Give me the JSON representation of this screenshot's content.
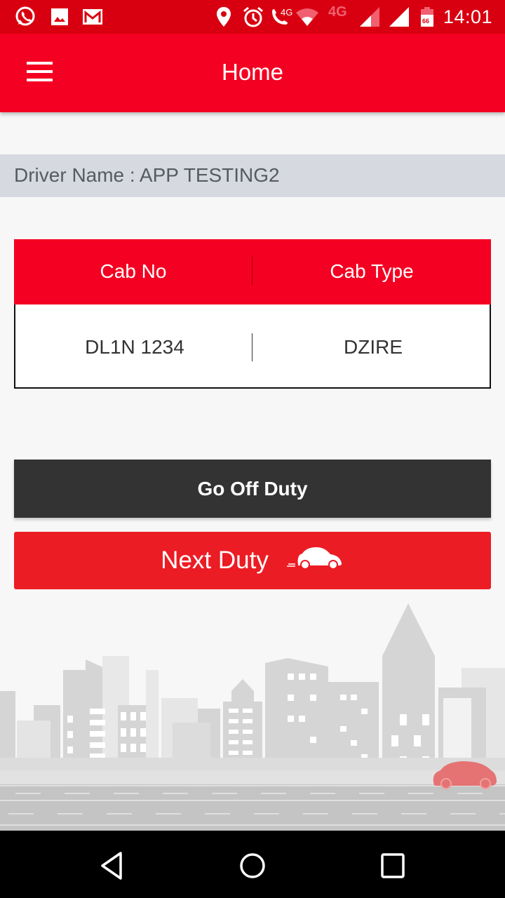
{
  "status_bar": {
    "left_icons": [
      "whatsapp-icon",
      "gallery-icon",
      "gmail-icon"
    ],
    "right_icons": [
      "location-icon",
      "alarm-icon",
      "volte-call-icon",
      "wifi-icon",
      "4g-icon",
      "signal-icon",
      "signal-icon",
      "battery-icon"
    ],
    "call_label": "4G",
    "network_label": "4G",
    "battery_level": "66",
    "time": "14:01"
  },
  "app_bar": {
    "title": "Home",
    "menu_icon": "hamburger-menu-icon"
  },
  "driver": {
    "label": "Driver Name : APP TESTING2"
  },
  "cab_table": {
    "headers": [
      "Cab No",
      "Cab Type"
    ],
    "rows": [
      [
        "DL1N 1234",
        "DZIRE"
      ]
    ]
  },
  "buttons": {
    "go_off_duty": "Go Off Duty",
    "next_duty": "Next Duty"
  },
  "nav_bar": {
    "items": [
      "back-icon",
      "home-icon",
      "recents-icon"
    ]
  },
  "colors": {
    "status_bar": "#d80010",
    "app_bar": "#f40022",
    "next_duty": "#ec1c24",
    "go_off_duty": "#333333",
    "driver_row": "#d6dae0"
  }
}
